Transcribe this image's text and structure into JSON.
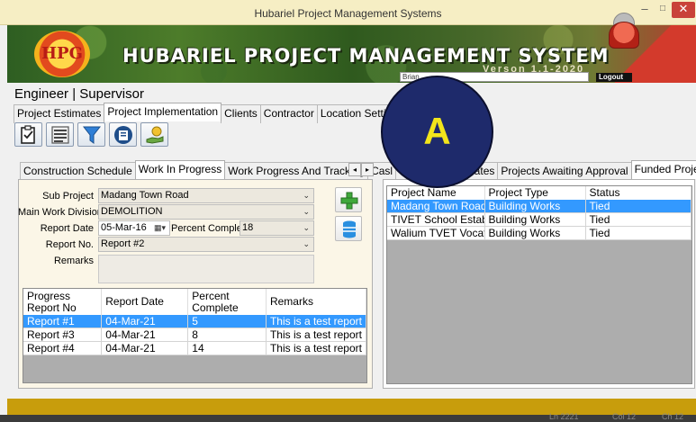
{
  "window": {
    "title": "Hubariel Project Management Systems",
    "minimize": "–",
    "maximize": "□",
    "close": "✕"
  },
  "banner": {
    "logo_text": "HPG",
    "title": "HUBARIEL PROJECT MANAGEMENT SYSTEM",
    "version": "Verson 1.1-2020",
    "user_box": "Brian",
    "logout": "Logout"
  },
  "user_role": "Engineer | Supervisor",
  "main_tabs": [
    "Project Estimates",
    "Project Implementation",
    "Clients",
    "Contractor",
    "Location Settings"
  ],
  "toolbar_icons": [
    "checklist-icon",
    "list-icon",
    "filter-icon",
    "book-icon",
    "money-hand-icon"
  ],
  "left_tabs": [
    "Construction Schedule",
    "Work In Progress",
    "Work Progress And Tracking",
    "Casl"
  ],
  "right_tabs": [
    "Project Estimates",
    "Projects Awaiting Approval",
    "Funded Projects"
  ],
  "form": {
    "sub_project_label": "Sub Project",
    "sub_project_value": "Madang Town Road",
    "division_label": "Main Work Division",
    "division_value": "DEMOLITION",
    "report_date_label": "Report Date",
    "report_date_value": "05-Mar-16",
    "percent_label": "Percent Complete",
    "percent_value": "18",
    "report_no_label": "Report No.",
    "report_no_value": "Report #2",
    "remarks_label": "Remarks",
    "remarks_value": ""
  },
  "progress_table": {
    "headers": [
      "Progress Report No",
      "Report Date",
      "Percent Complete",
      "Remarks"
    ],
    "rows": [
      [
        "Report #1",
        "04-Mar-21",
        "5",
        "This is a test report"
      ],
      [
        "Report #3",
        "04-Mar-21",
        "8",
        "This is a test report"
      ],
      [
        "Report #4",
        "04-Mar-21",
        "14",
        "This is a test report"
      ]
    ]
  },
  "projects_table": {
    "headers": [
      "Project Name",
      "Project Type",
      "Status"
    ],
    "rows": [
      [
        "Madang Town Road...",
        "Building Works",
        "Tied"
      ],
      [
        "TIVET School Establ...",
        "Building Works",
        "Tied"
      ],
      [
        "Walium TVET Vocati...",
        "Building Works",
        "Tied"
      ]
    ]
  },
  "status_bar": {
    "ln": "Ln 2221",
    "col": "Col 12",
    "ch": "Ch 12"
  },
  "annotation": "A",
  "colors": {
    "selection": "#3399ff",
    "footer": "#c89d0c",
    "overlay": "#1e2a6b",
    "overlay_text": "#f2e51b"
  }
}
